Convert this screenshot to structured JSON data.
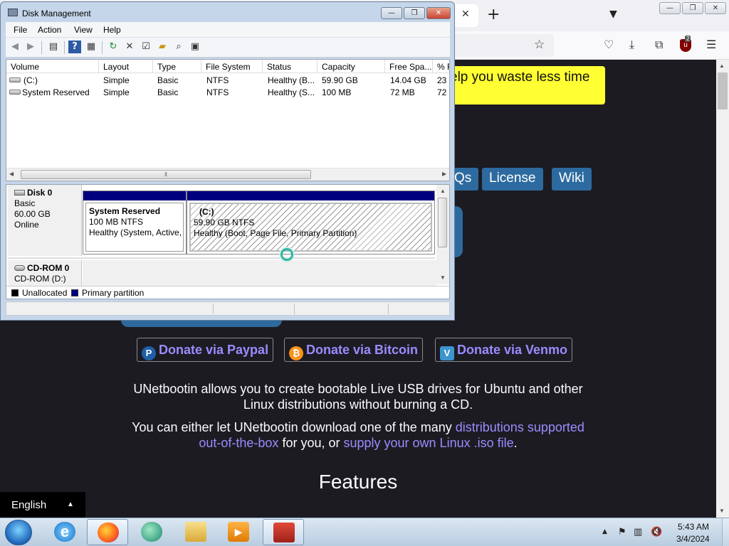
{
  "firefox": {
    "tab_close": "✕",
    "new_tab": "+",
    "list_tabs": "⌄",
    "window_controls": {
      "minimize": "—",
      "restore": "❐",
      "close": "✕"
    },
    "extension_badge": "2",
    "icons": [
      "star-icon",
      "pocket-icon",
      "download-icon",
      "extensions-icon",
      "ublock-icon",
      "menu-icon"
    ]
  },
  "page": {
    "banner_text": "elp you waste less time",
    "nav": [
      {
        "label": "Qs"
      },
      {
        "label": "License"
      },
      {
        "label": "Wiki"
      }
    ],
    "donate": [
      {
        "label": "Donate via Paypal",
        "icon": "P",
        "color": "#1f5fa8"
      },
      {
        "label": "Donate via Bitcoin",
        "icon": "₿",
        "color": "#f7931a"
      },
      {
        "label": "Donate via Venmo",
        "icon": "V",
        "color": "#3d95ce"
      }
    ],
    "intro": {
      "line1": "UNetbootin allows you to create bootable Live USB drives for Ubuntu and other",
      "line2": "Linux distributions without burning a CD."
    },
    "download": {
      "pre": "You can either let UNetbootin download one of the many ",
      "link1a": "distributions supported",
      "link1b": "out-of-the-box",
      "mid": " for you, or ",
      "link2": "supply your own Linux .iso file",
      "post": "."
    },
    "features_heading": "Features",
    "language": "English"
  },
  "disk_management": {
    "title": "Disk Management",
    "menu": [
      "File",
      "Action",
      "View",
      "Help"
    ],
    "columns": [
      "Volume",
      "Layout",
      "Type",
      "File System",
      "Status",
      "Capacity",
      "Free Spa...",
      "% F"
    ],
    "volumes": [
      [
        "(C:)",
        "Simple",
        "Basic",
        "NTFS",
        "Healthy (B...",
        "59.90 GB",
        "14.04 GB",
        "23"
      ],
      [
        "System Reserved",
        "Simple",
        "Basic",
        "NTFS",
        "Healthy (S...",
        "100 MB",
        "72 MB",
        "72"
      ]
    ],
    "disks": [
      {
        "name": "Disk 0",
        "type": "Basic",
        "size": "60.00 GB",
        "state": "Online",
        "partitions": [
          {
            "name": "System Reserved",
            "size": "100 MB NTFS",
            "status": "Healthy (System, Active,"
          },
          {
            "name": "(C:)",
            "size": "59.90 GB NTFS",
            "status": "Healthy (Boot, Page File, Primary Partition)"
          }
        ]
      },
      {
        "name": "CD-ROM 0",
        "type": "CD-ROM (D:)"
      }
    ],
    "legend": [
      "Unallocated",
      "Primary partition"
    ],
    "legend_colors": [
      "#000000",
      "#00007f"
    ]
  },
  "taskbar": {
    "apps": [
      "internet-explorer",
      "firefox",
      "media-center",
      "windows-explorer",
      "media-player",
      "disk-management"
    ],
    "time": "5:43 AM",
    "date": "3/4/2024"
  }
}
